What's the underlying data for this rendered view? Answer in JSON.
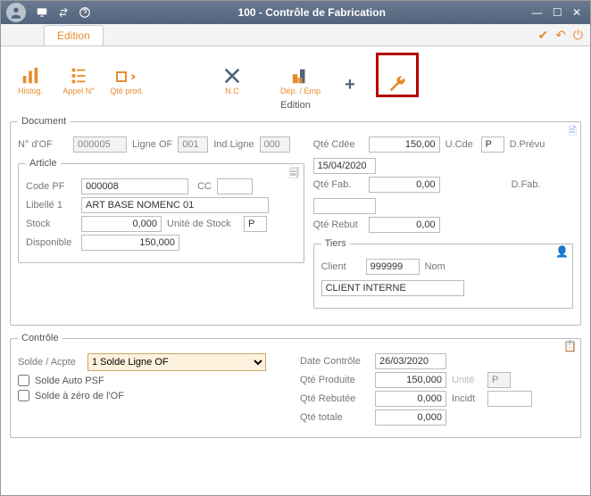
{
  "titlebar": {
    "title": "100 - Contrôle de Fabrication"
  },
  "tabbar": {
    "active": "Edition"
  },
  "toolbar": {
    "histog": "Histog.",
    "appel": "Appel N°",
    "qteprod": "Qté prod.",
    "nc": "N.C",
    "depemp": "Dép. / Emp",
    "plus": "",
    "wrench": "",
    "sublabel": "Edition"
  },
  "document": {
    "legend": "Document",
    "no_of_label": "N° d'OF",
    "no_of": "000005",
    "ligne_of_label": "Ligne OF",
    "ligne_of": "001",
    "ind_ligne_label": "Ind.Ligne",
    "ind_ligne": "000",
    "qte_cdee_label": "Qté Cdée",
    "qte_cdee": "150,00",
    "ucde_label": "U.Cde",
    "ucde": "P",
    "dprevu_label": "D.Prévu",
    "dprevu": "15/04/2020",
    "qte_fab_label": "Qté Fab.",
    "qte_fab": "0,00",
    "dfab_label": "D.Fab.",
    "dfab": "",
    "qte_rebut_label": "Qté Rebut",
    "qte_rebut": "0,00"
  },
  "article": {
    "legend": "Article",
    "code_pf_label": "Code PF",
    "code_pf": "000008",
    "cc_label": "CC",
    "cc": "",
    "libelle_label": "Libellé 1",
    "libelle": "ART BASE NOMENC 01",
    "stock_label": "Stock",
    "stock": "0,000",
    "unit_stock_label": "Unité de Stock",
    "unit_stock": "P",
    "dispo_label": "Disponible",
    "dispo": "150,000"
  },
  "tiers": {
    "legend": "Tiers",
    "client_label": "Client",
    "client": "999999",
    "nom_label": "Nom",
    "nom": "CLIENT INTERNE"
  },
  "controle": {
    "legend": "Contrôle",
    "solde_acpte_label": "Solde / Acpte",
    "solde_acpte": "1  Solde Ligne OF",
    "solde_auto_psf": "Solde Auto PSF",
    "solde_zero_of": "Solde à zéro de l'OF",
    "date_ctrl_label": "Date Contrôle",
    "date_ctrl": "26/03/2020",
    "qte_prod_label": "Qté Produite",
    "qte_prod": "150,000",
    "unite_label": "Unité",
    "unite": "P",
    "qte_rebut_label": "Qté Rebutée",
    "qte_rebut": "0,000",
    "incidt_label": "Incidt",
    "incidt": "",
    "qte_totale_label": "Qté totale",
    "qte_totale": "0,000"
  }
}
